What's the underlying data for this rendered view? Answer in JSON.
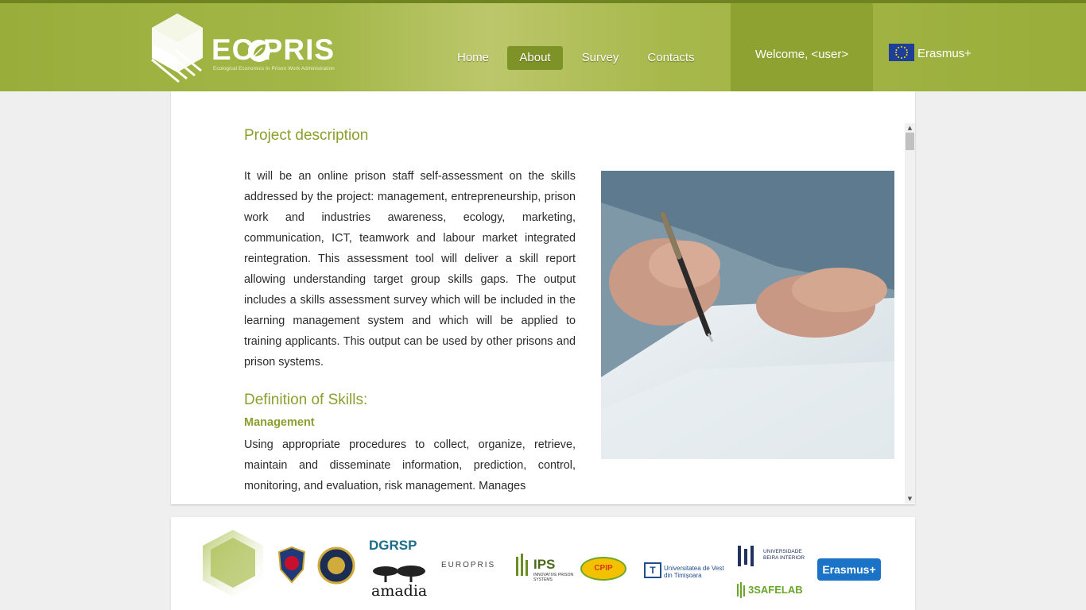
{
  "header": {
    "logo_text": "EC PRIS",
    "logo_subtitle": "Ecological Economics In Prison Work Administration",
    "nav": [
      {
        "label": "Home"
      },
      {
        "label": "About",
        "active": true
      },
      {
        "label": "Survey"
      },
      {
        "label": "Contacts"
      }
    ],
    "welcome": "Welcome, <user>",
    "erasmus_label": "Erasmus+"
  },
  "content": {
    "title": "Project description",
    "description": "It will be an online prison staff self-assessment on the skills addressed by the project: management, entrepreneurship, prison work and industries awareness, ecology, marketing, communication, ICT, teamwork and labour market integrated reintegration. This assessment tool will deliver a skill report allowing understanding target group skills gaps. The output includes a skills assessment survey which will be included in the learning management system and which will be applied to training applicants. This output can be used by other prisons and prison systems.",
    "skills_title": "Definition of Skills:",
    "management_title": "Management",
    "management_text": "Using appropriate procedures to collect, organize, retrieve, maintain and disseminate information, prediction, control, monitoring, and evaluation, risk management. Manages"
  },
  "footer": {
    "partners": {
      "dgrsp": "DGRSP",
      "amadia": "amadia",
      "europris": "EUROPRIS",
      "ips": "IPS",
      "ips_sub": "INNOVATIVE PRISON SYSTEMS",
      "cpip": "CPIP",
      "uvt": "Universitatea de Vest din Timișoara",
      "ubi": "UNIVERSIDADE BEIRA INTERIOR",
      "safelab": "3SAFELAB",
      "erasmus": "Erasmus+"
    }
  },
  "colors": {
    "header_green": "#98ad3a",
    "active_nav": "#7d9328",
    "heading_green": "#8aa02e",
    "welcome_bg": "#8ea232"
  }
}
